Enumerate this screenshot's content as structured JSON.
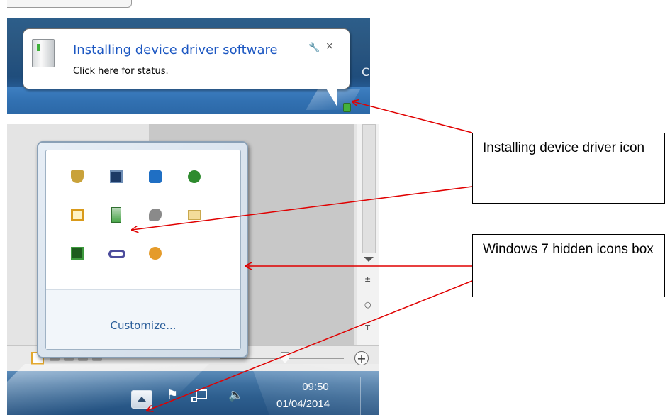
{
  "balloon": {
    "title": "Installing device driver software",
    "subtitle": "Click here for status.",
    "options_icon": "wrench-icon",
    "close_label": "×",
    "partial_text": "C"
  },
  "hidden_icons_box": {
    "icons": [
      {
        "name": "security-shield-icon",
        "color": "#c9a23a"
      },
      {
        "name": "monitor-display-icon",
        "color": "#1d3a66"
      },
      {
        "name": "media-play-icon",
        "color": "#1f6fc4"
      },
      {
        "name": "globe-update-icon",
        "color": "#2e8b2e"
      },
      {
        "name": "orange-ring-icon",
        "color": "#d99a1a"
      },
      {
        "name": "device-driver-icon",
        "color": "#4aa64a"
      },
      {
        "name": "grey-animal-icon",
        "color": "#8a8a8a"
      },
      {
        "name": "mail-envelope-icon",
        "color": "#e6c46a"
      },
      {
        "name": "green-chip-icon",
        "color": "#2a7a2a"
      },
      {
        "name": "link-infinity-icon",
        "color": "#4c4c9c"
      },
      {
        "name": "orange-upload-icon",
        "color": "#e59b2a"
      }
    ],
    "customize_label": "Customize..."
  },
  "taskbar": {
    "time": "09:50",
    "date": "01/04/2014",
    "flag_glyph": "⚑",
    "volume_glyph": "🔈"
  },
  "scrollbar": {
    "up_glyph": "±",
    "mid_glyph": "○",
    "down_glyph": "∓"
  },
  "status_bar": {
    "zoom_plus": "+"
  },
  "annotations": [
    {
      "text": "Installing device driver icon"
    },
    {
      "text": "Windows 7 hidden icons box"
    }
  ]
}
